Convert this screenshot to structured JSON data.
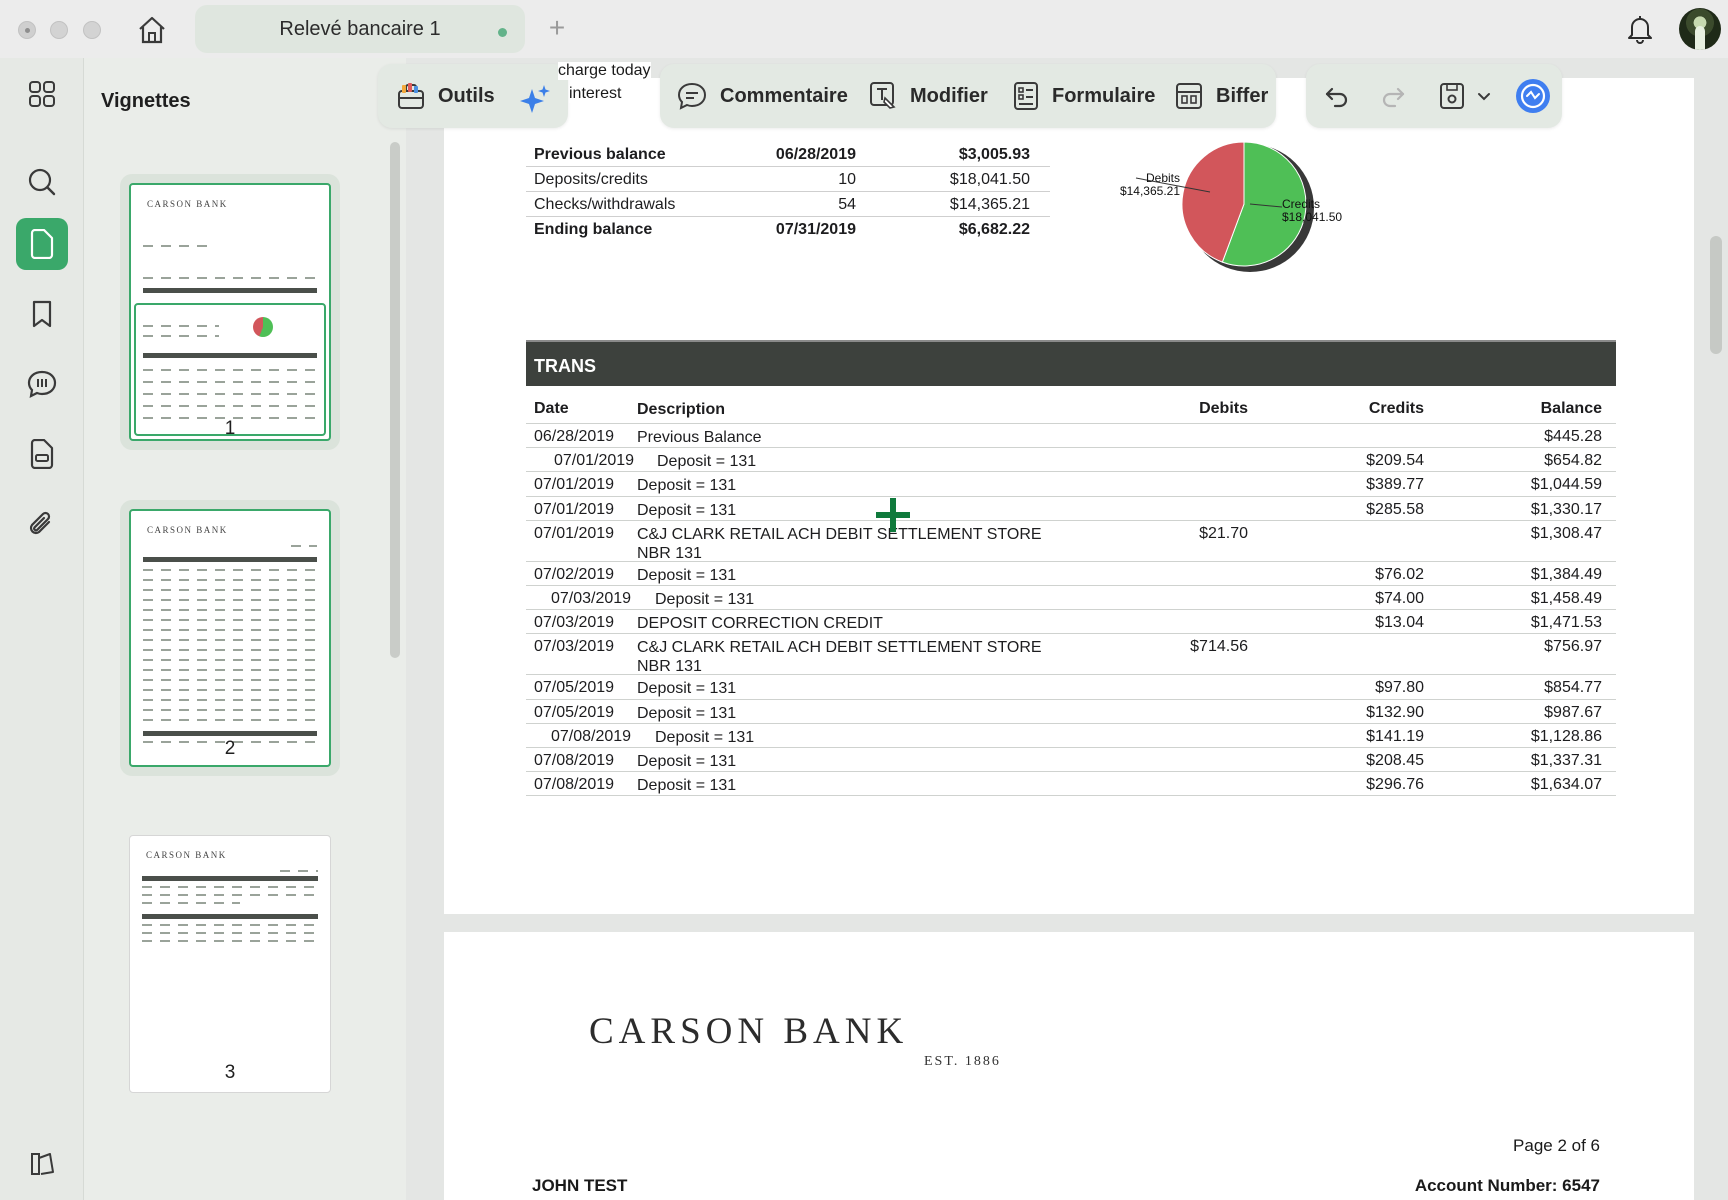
{
  "window": {
    "tab_title": "Relevé bancaire 1",
    "new_tab_label": "+"
  },
  "sidebar": {
    "title": "Vignettes",
    "thumbnails": [
      {
        "label": "1",
        "bank": "CARSON BANK"
      },
      {
        "label": "2",
        "bank": "CARSON BANK"
      },
      {
        "label": "3",
        "bank": "CARSON BANK"
      }
    ]
  },
  "toolbar": {
    "tools_label": "Outils",
    "comment_label": "Commentaire",
    "edit_label": "Modifier",
    "form_label": "Formulaire",
    "redact_label": "Biffer"
  },
  "behind_toolbar_text": [
    "charge today",
    "interest"
  ],
  "summary": {
    "rows": [
      {
        "label": "Previous balance",
        "col2": "06/28/2019",
        "amount": "$3,005.93",
        "bold": true
      },
      {
        "label": "Deposits/credits",
        "col2": "10",
        "amount": "$18,041.50",
        "bold": false
      },
      {
        "label": "Checks/withdrawals",
        "col2": "54",
        "amount": "$14,365.21",
        "bold": false
      },
      {
        "label": "Ending balance",
        "col2": "07/31/2019",
        "amount": "$6,682.22",
        "bold": true
      }
    ]
  },
  "pie": {
    "debits_label": "Debits",
    "debits_amount": "$14,365.21",
    "credits_label": "Credits",
    "credits_amount": "$18,041.50",
    "debits_value": 14365.21,
    "credits_value": 18041.5,
    "debit_color": "#d2565b",
    "credit_color": "#4fbf56"
  },
  "transactions": {
    "title": "TRANS",
    "headers": {
      "date": "Date",
      "description": "Description",
      "debits": "Debits",
      "credits": "Credits",
      "balance": "Balance"
    },
    "rows": [
      {
        "date": "06/28/2019",
        "desc": "Previous Balance",
        "debit": "",
        "credit": "",
        "balance": "$445.28",
        "indent": 0
      },
      {
        "date": "07/01/2019",
        "desc": "Deposit = 131",
        "debit": "",
        "credit": "$209.54",
        "balance": "$654.82",
        "indent": 1
      },
      {
        "date": "07/01/2019",
        "desc": "Deposit = 131",
        "debit": "",
        "credit": "$389.77",
        "balance": "$1,044.59",
        "indent": 0
      },
      {
        "date": "07/01/2019",
        "desc": "Deposit = 131",
        "debit": "",
        "credit": "$285.58",
        "balance": "$1,330.17",
        "indent": 0
      },
      {
        "date": "07/01/2019",
        "desc": "C&J CLARK RETAIL ACH DEBIT SETTLEMENT STORE NBR 131",
        "debit": "$21.70",
        "credit": "",
        "balance": "$1,308.47",
        "indent": 0
      },
      {
        "date": "07/02/2019",
        "desc": "Deposit = 131",
        "debit": "",
        "credit": "$76.02",
        "balance": "$1,384.49",
        "indent": 0
      },
      {
        "date": "07/03/2019",
        "desc": "Deposit = 131",
        "debit": "",
        "credit": "$74.00",
        "balance": "$1,458.49",
        "indent": 2
      },
      {
        "date": "07/03/2019",
        "desc": "DEPOSIT CORRECTION CREDIT",
        "debit": "",
        "credit": "$13.04",
        "balance": "$1,471.53",
        "indent": 0
      },
      {
        "date": "07/03/2019",
        "desc": "C&J CLARK RETAIL ACH DEBIT SETTLEMENT STORE NBR 131",
        "debit": "$714.56",
        "credit": "",
        "balance": "$756.97",
        "indent": 0
      },
      {
        "date": "07/05/2019",
        "desc": "Deposit = 131",
        "debit": "",
        "credit": "$97.80",
        "balance": "$854.77",
        "indent": 0
      },
      {
        "date": "07/05/2019",
        "desc": "Deposit = 131",
        "debit": "",
        "credit": "$132.90",
        "balance": "$987.67",
        "indent": 0
      },
      {
        "date": "07/08/2019",
        "desc": "Deposit = 131",
        "debit": "",
        "credit": "$141.19",
        "balance": "$1,128.86",
        "indent": 2
      },
      {
        "date": "07/08/2019",
        "desc": "Deposit = 131",
        "debit": "",
        "credit": "$208.45",
        "balance": "$1,337.31",
        "indent": 0
      },
      {
        "date": "07/08/2019",
        "desc": "Deposit = 131",
        "debit": "",
        "credit": "$296.76",
        "balance": "$1,634.07",
        "indent": 0
      }
    ]
  },
  "page2": {
    "bank_name": "CARSON BANK",
    "established": "EST. 1886",
    "page_info": "Page 2 of 6",
    "customer_name": "JOHN TEST",
    "account_label": "Account Number:",
    "account_number": "6547"
  },
  "colors": {
    "accent": "#3aa86a",
    "trans_header_bg": "#3d413d"
  }
}
